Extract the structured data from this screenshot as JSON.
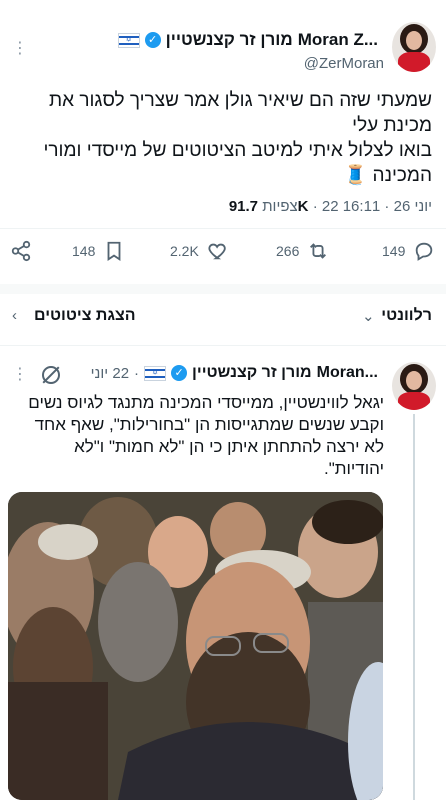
{
  "tweet": {
    "author_name": "Moran Z...",
    "author_name_he": "מורן זר קצנשטיין",
    "handle": "@ZerMoran",
    "text_line1": "שמעתי שזה הם שיאיר גולן אמר שצריך לסגור את",
    "text_line2": "מכינת עלי",
    "text_line3": "בואו לצלול איתי למיטב הציטוטים של מייסדי ומורי",
    "text_line4": "המכינה 🧵",
    "time": "16:11",
    "date": "22 יוני 26",
    "views_count": "91.7K",
    "views_label": "צפיות",
    "replies": "149",
    "retweets": "266",
    "likes": "2.2K",
    "bookmarks": "148"
  },
  "filter": {
    "relevant_label": "רלוונטי",
    "quotes_label": "הצגת ציטוטים"
  },
  "reply": {
    "author_name": "Moran...",
    "author_name_he": "מורן זר קצנשטיין",
    "date": "22 יוני",
    "line1": "יגאל לווינשטיין, ממייסדי המכינה מתנגד לגיוס נשים",
    "line2": "וקבע שנשים שמתגייסות הן \"בחורילות\", שאף אחד",
    "line3": "לא ירצה להתחתן איתן כי הן \"לא חמות\" ו\"לא",
    "line4": "יהודיות\"."
  },
  "icons": {
    "more": "more-dots-icon",
    "verified": "verified-badge-icon",
    "flag": "israel-flag-icon",
    "reply": "reply-icon",
    "retweet": "retweet-icon",
    "like": "heart-icon",
    "bookmark": "bookmark-icon",
    "share": "share-icon"
  },
  "colors": {
    "accent": "#1d9bf0",
    "muted": "#536471",
    "text": "#0f1419"
  }
}
